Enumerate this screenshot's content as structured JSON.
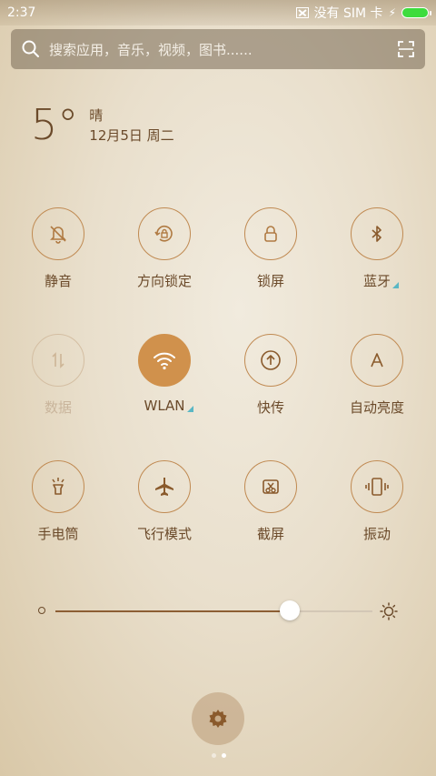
{
  "status": {
    "time": "2:37",
    "sim_text": "没有 SIM 卡",
    "battery_color": "#3ddc3d"
  },
  "search": {
    "placeholder": "搜索应用，音乐，视频，图书......"
  },
  "weather": {
    "temperature": "5°",
    "condition": "晴",
    "date": "12月5日 周二"
  },
  "toggles": [
    {
      "label": "静音",
      "icon": "bell-off-icon",
      "state": "off"
    },
    {
      "label": "方向锁定",
      "icon": "rotation-lock-icon",
      "state": "off"
    },
    {
      "label": "锁屏",
      "icon": "lock-icon",
      "state": "off"
    },
    {
      "label": "蓝牙",
      "icon": "bluetooth-icon",
      "state": "off",
      "expandable": true
    },
    {
      "label": "数据",
      "icon": "mobile-data-icon",
      "state": "disabled"
    },
    {
      "label": "WLAN",
      "icon": "wifi-icon",
      "state": "on",
      "expandable": true
    },
    {
      "label": "快传",
      "icon": "upload-icon",
      "state": "off"
    },
    {
      "label": "自动亮度",
      "icon": "auto-brightness-icon",
      "state": "off"
    },
    {
      "label": "手电筒",
      "icon": "flashlight-icon",
      "state": "off"
    },
    {
      "label": "飞行模式",
      "icon": "airplane-icon",
      "state": "off"
    },
    {
      "label": "截屏",
      "icon": "screenshot-icon",
      "state": "off"
    },
    {
      "label": "振动",
      "icon": "vibrate-icon",
      "state": "off"
    }
  ],
  "brightness": {
    "level": 0.74
  },
  "colors": {
    "accent": "#d0914c",
    "text": "#6b4a2a",
    "expand_marker": "#5ab7c4"
  },
  "pages": {
    "count": 2,
    "current": 2
  }
}
